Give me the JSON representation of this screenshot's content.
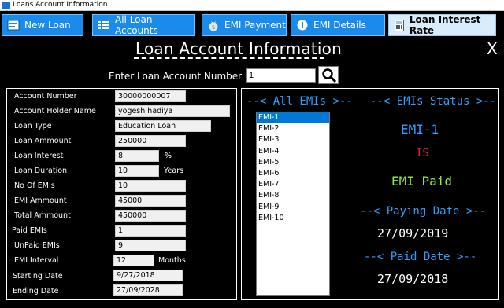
{
  "window": {
    "title": "Loans Account Information"
  },
  "toolbar": {
    "new_loan": "New Loan",
    "all_loan_accounts": "All Loan Accounts",
    "emi_payment": "EMI Payment",
    "emi_details": "EMI  Details",
    "loan_interest_rate": "Loan Interest Rate"
  },
  "header": {
    "title": "Loan Account Information",
    "close": "X"
  },
  "search": {
    "label": "Enter Loan Account Number ::",
    "value": "1"
  },
  "fields": {
    "account_number": {
      "label": "Account Number",
      "value": "30000000007"
    },
    "holder_name": {
      "label": "Account Holder Name",
      "value": "yogesh hadiya"
    },
    "loan_type": {
      "label": "Loan Type",
      "value": "Education Loan"
    },
    "loan_amount": {
      "label": "Loan Ammount",
      "value": "250000"
    },
    "loan_interest": {
      "label": "Loan Interest",
      "value": "8",
      "unit": "%"
    },
    "loan_duration": {
      "label": "Loan Duration",
      "value": "10",
      "unit": "Years"
    },
    "no_of_emis": {
      "label": "No Of EMIs",
      "value": "10"
    },
    "emi_amount": {
      "label": "EMI Ammount",
      "value": "45000"
    },
    "total_amount": {
      "label": "Total Ammount",
      "value": "450000"
    },
    "paid_emis": {
      "label": "Paid EMIs",
      "value": "1"
    },
    "unpaid_emis": {
      "label": "UnPaid EMIs",
      "value": "9"
    },
    "emi_interval": {
      "label": "EMI Interval",
      "value": "12",
      "unit": "Months"
    },
    "starting_date": {
      "label": "Starting Date",
      "value": "9/27/2018"
    },
    "ending_date": {
      "label": "Ending Date",
      "value": "27/09/2028"
    }
  },
  "emis": {
    "heading": "--< All EMIs >--",
    "items": [
      "EMI-1",
      "EMI-2",
      "EMI-3",
      "EMI-4",
      "EMI-5",
      "EMI-6",
      "EMI-7",
      "EMI-8",
      "EMI-9",
      "EMI-10"
    ],
    "selected": "EMI-1"
  },
  "status": {
    "heading": "--< EMIs Status >--",
    "emi": "EMI-1",
    "is": "IS",
    "state": "EMI Paid",
    "paying_heading": "--< Paying Date >--",
    "paying_date": "27/09/2019",
    "paid_heading": "--< Paid Date >--",
    "paid_date": "27/09/2018"
  },
  "colors": {
    "accent": "#1a8bea",
    "status_blue": "#2ca0ff",
    "status_red": "#ff2020",
    "status_green": "#8cf03c"
  }
}
